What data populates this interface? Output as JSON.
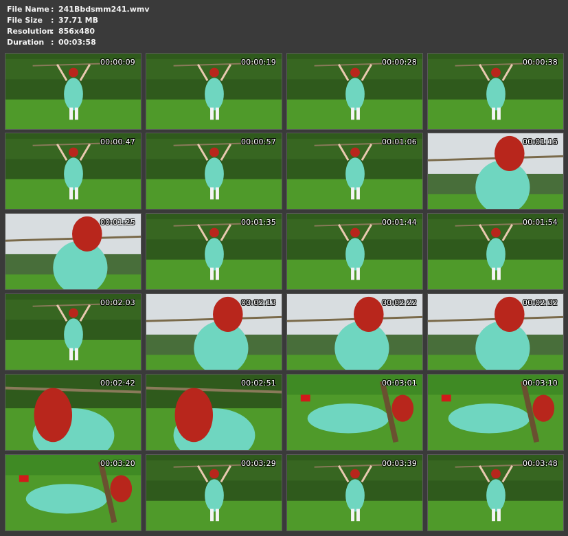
{
  "file_info": {
    "rows": [
      {
        "label": "File Name",
        "sep": ":",
        "value": "241Bbdsmm241.wmv"
      },
      {
        "label": "File Size",
        "sep": ":",
        "value": "37.71 MB"
      },
      {
        "label": "Resolution",
        "sep": ":",
        "value": "856x480"
      },
      {
        "label": "Duration",
        "sep": ":",
        "value": "00:03:58"
      }
    ]
  },
  "thumbnails": [
    {
      "time": "00:00:09",
      "scene": "field"
    },
    {
      "time": "00:00:19",
      "scene": "field"
    },
    {
      "time": "00:00:28",
      "scene": "field"
    },
    {
      "time": "00:00:38",
      "scene": "field"
    },
    {
      "time": "00:00:47",
      "scene": "field"
    },
    {
      "time": "00:00:57",
      "scene": "field"
    },
    {
      "time": "00:01:06",
      "scene": "field"
    },
    {
      "time": "00:01:16",
      "scene": "sky"
    },
    {
      "time": "00:01:25",
      "scene": "sky"
    },
    {
      "time": "00:01:35",
      "scene": "field"
    },
    {
      "time": "00:01:44",
      "scene": "field"
    },
    {
      "time": "00:01:54",
      "scene": "field"
    },
    {
      "time": "00:02:03",
      "scene": "field"
    },
    {
      "time": "00:02:13",
      "scene": "sky"
    },
    {
      "time": "00:02:22",
      "scene": "sky"
    },
    {
      "time": "00:02:32",
      "scene": "sky"
    },
    {
      "time": "00:02:42",
      "scene": "close"
    },
    {
      "time": "00:02:51",
      "scene": "close"
    },
    {
      "time": "00:03:01",
      "scene": "grass"
    },
    {
      "time": "00:03:10",
      "scene": "grass"
    },
    {
      "time": "00:03:20",
      "scene": "grass"
    },
    {
      "time": "00:03:29",
      "scene": "field"
    },
    {
      "time": "00:03:39",
      "scene": "field"
    },
    {
      "time": "00:03:48",
      "scene": "field"
    }
  ],
  "colors": {
    "background": "#3a3a3a",
    "text": "#f2f2f2",
    "hedge": "#2f5a1c",
    "grass": "#4f9a2a",
    "sky": "#d8dde0",
    "uniform": "#6fd6c0",
    "hair": "#b8261c"
  }
}
